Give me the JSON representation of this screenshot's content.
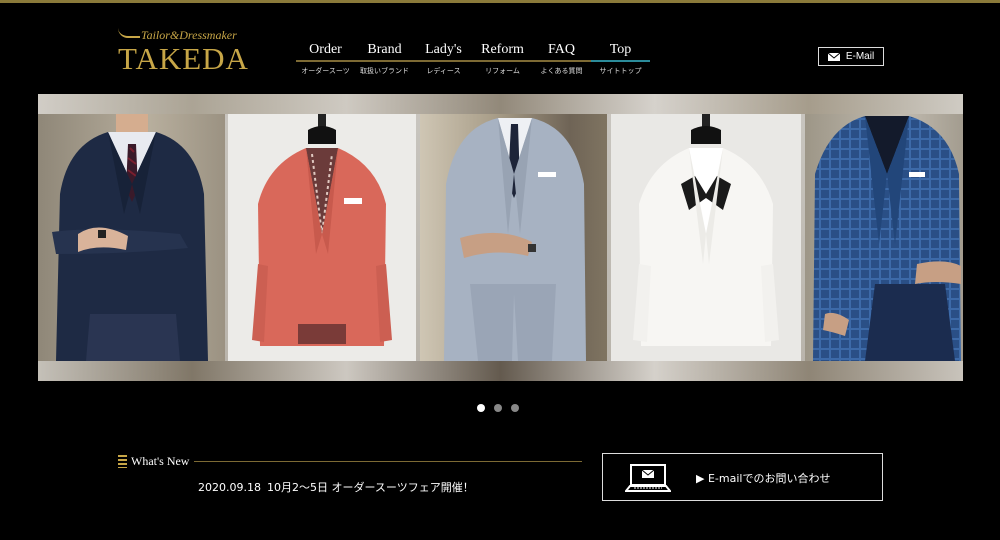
{
  "logo": {
    "tagline": "Tailor&Dressmaker",
    "name": "TAKEDA"
  },
  "nav": [
    {
      "en": "Order",
      "jp": "オーダースーツ"
    },
    {
      "en": "Brand",
      "jp": "取扱いブランド"
    },
    {
      "en": "Lady's",
      "jp": "レディース"
    },
    {
      "en": "Reform",
      "jp": "リフォーム"
    },
    {
      "en": "FAQ",
      "jp": "よくある質問"
    },
    {
      "en": "Top",
      "jp": "サイトトップ"
    }
  ],
  "email_button": {
    "label": "E-Mail",
    "icon": "envelope-icon"
  },
  "slider": {
    "slides": [
      {
        "icon": "navy-suit-model-photo"
      },
      {
        "icon": "coral-jacket-mannequin-photo"
      },
      {
        "icon": "grey-suit-model-photo"
      },
      {
        "icon": "white-tuxedo-mannequin-photo"
      },
      {
        "icon": "blue-check-jacket-model-photo"
      }
    ],
    "page_count": 3,
    "active_page": 1
  },
  "news": {
    "heading": "What's New",
    "items": [
      {
        "date": "2020.09.18",
        "text": "10月2〜5日 オーダースーツフェア開催！"
      }
    ]
  },
  "contact": {
    "label": "▶ E-mailでのお問い合わせ",
    "icon": "laptop-mail-icon"
  },
  "colors": {
    "gold": "#c7a647",
    "accent_teal": "#2b8b9a",
    "background": "#000000"
  }
}
